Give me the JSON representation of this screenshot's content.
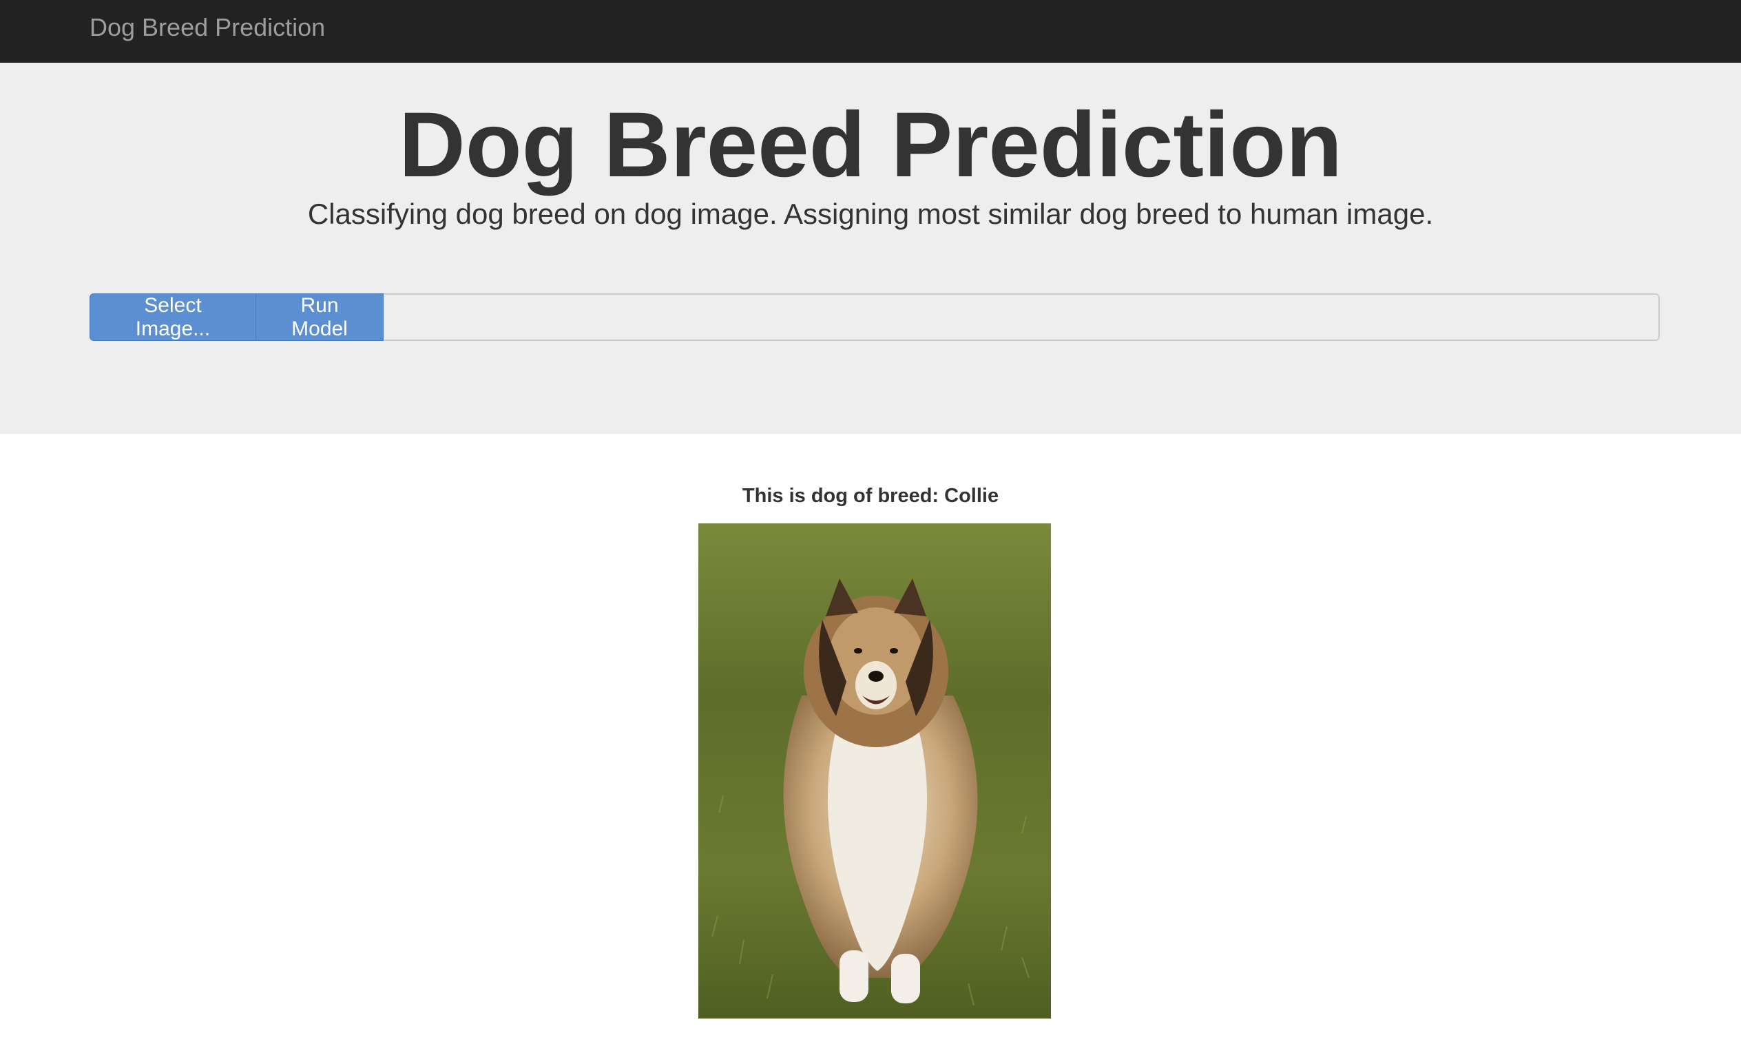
{
  "navbar": {
    "brand": "Dog Breed Prediction"
  },
  "header": {
    "title": "Dog Breed Prediction",
    "subtitle": "Classifying dog breed on dog image. Assigning most similar dog breed to human image."
  },
  "controls": {
    "select_label": "Select Image...",
    "run_label": "Run Model",
    "file_value": ""
  },
  "result": {
    "label": "This is dog of breed: Collie"
  },
  "colors": {
    "navbar_bg": "#222222",
    "jumbotron_bg": "#eeeeee",
    "button_bg": "#5b8fd2",
    "text": "#333333"
  }
}
